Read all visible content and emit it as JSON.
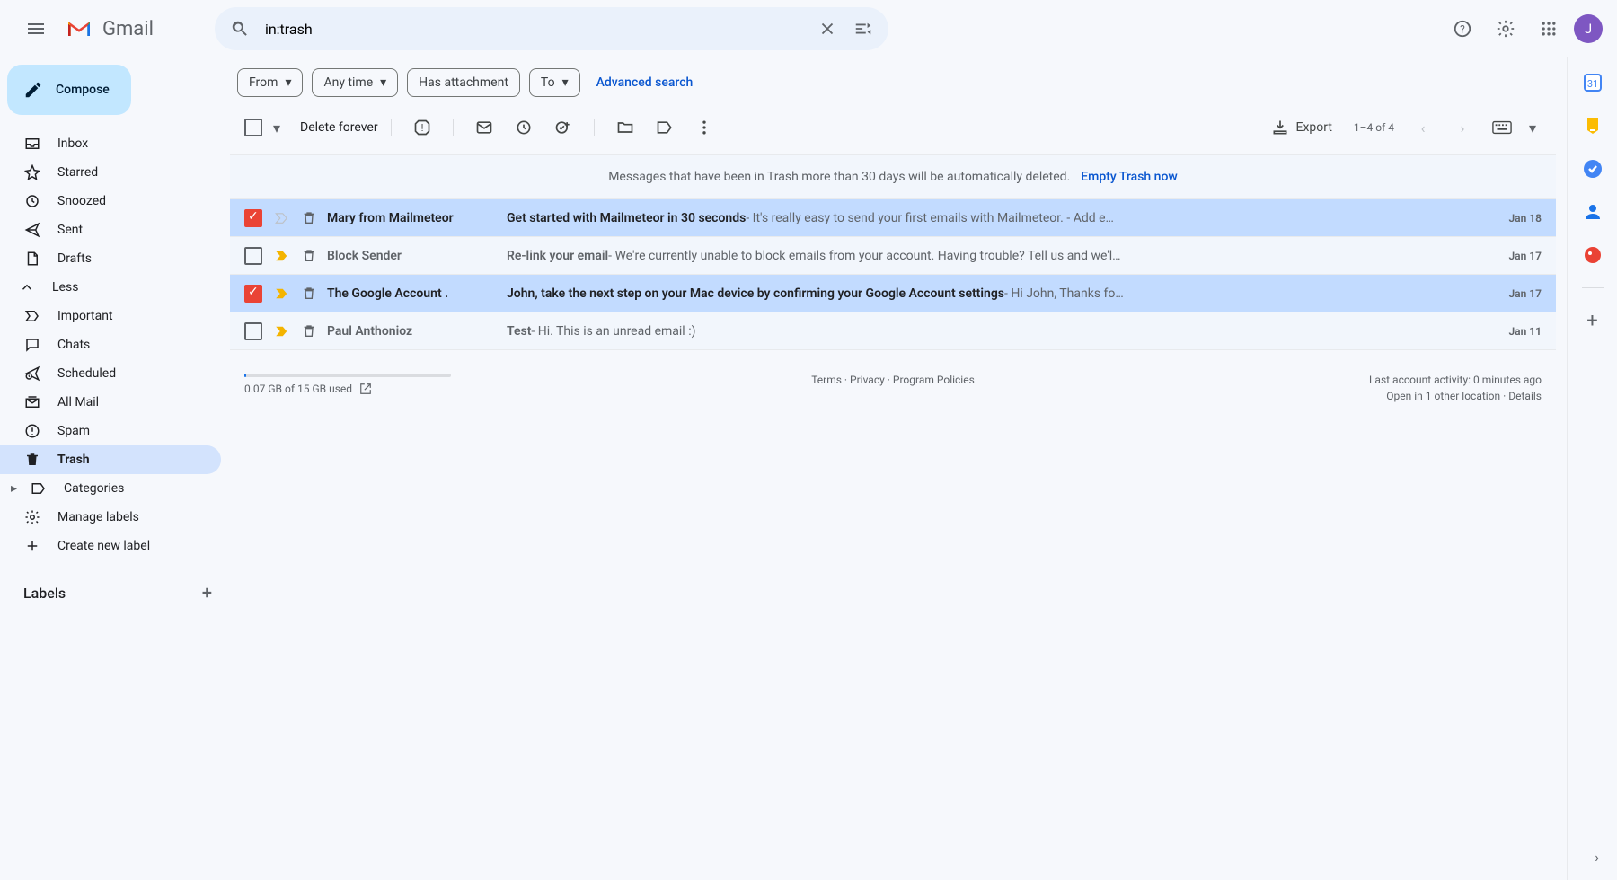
{
  "app": {
    "name": "Gmail",
    "avatar_initial": "J"
  },
  "search": {
    "value": "in:trash"
  },
  "sidebar": {
    "compose": "Compose",
    "items": [
      {
        "label": "Inbox",
        "icon": "inbox"
      },
      {
        "label": "Starred",
        "icon": "star"
      },
      {
        "label": "Snoozed",
        "icon": "clock"
      },
      {
        "label": "Sent",
        "icon": "send"
      },
      {
        "label": "Drafts",
        "icon": "draft"
      },
      {
        "label": "Less",
        "icon": "chevron-up"
      },
      {
        "label": "Important",
        "icon": "important"
      },
      {
        "label": "Chats",
        "icon": "chat"
      },
      {
        "label": "Scheduled",
        "icon": "scheduled"
      },
      {
        "label": "All Mail",
        "icon": "allmail"
      },
      {
        "label": "Spam",
        "icon": "spam"
      },
      {
        "label": "Trash",
        "icon": "trash",
        "active": true
      },
      {
        "label": "Categories",
        "icon": "categories"
      },
      {
        "label": "Manage labels",
        "icon": "settings"
      },
      {
        "label": "Create new label",
        "icon": "plus"
      }
    ],
    "labels_header": "Labels"
  },
  "filters": {
    "from": "From",
    "anytime": "Any time",
    "has_attachment": "Has attachment",
    "to": "To",
    "advanced": "Advanced search"
  },
  "toolbar": {
    "delete_forever": "Delete forever",
    "export": "Export",
    "pager": "1–4 of 4"
  },
  "trash_notice": {
    "message": "Messages that have been in Trash more than 30 days will be automatically deleted.",
    "empty_link": "Empty Trash now"
  },
  "emails": [
    {
      "selected": true,
      "important_arrow": false,
      "sender": "Mary from Mailmeteor",
      "subject": "Get started with Mailmeteor in 30 seconds",
      "snippet": " - It's really easy to send your first emails with Mailmeteor. - Add e…",
      "date": "Jan 18"
    },
    {
      "selected": false,
      "important_arrow": true,
      "sender": "Block Sender",
      "subject": "Re-link your email",
      "snippet": " - We're currently unable to block emails from your account. Having trouble? Tell us and we'l…",
      "date": "Jan 17"
    },
    {
      "selected": true,
      "important_arrow": true,
      "sender": "The Google Account .",
      "subject": "John, take the next step on your Mac device by confirming your Google Account settings",
      "snippet": " - Hi John, Thanks fo…",
      "date": "Jan 17"
    },
    {
      "selected": false,
      "important_arrow": true,
      "sender": "Paul Anthonioz",
      "subject": "Test",
      "snippet": " - Hi. This is an unread email :)",
      "date": "Jan 11"
    }
  ],
  "footer": {
    "storage": "0.07 GB of 15 GB used",
    "terms": "Terms",
    "privacy": "Privacy",
    "policies": "Program Policies",
    "activity": "Last account activity: 0 minutes ago",
    "open_in": "Open in 1 other location · ",
    "details": "Details"
  }
}
